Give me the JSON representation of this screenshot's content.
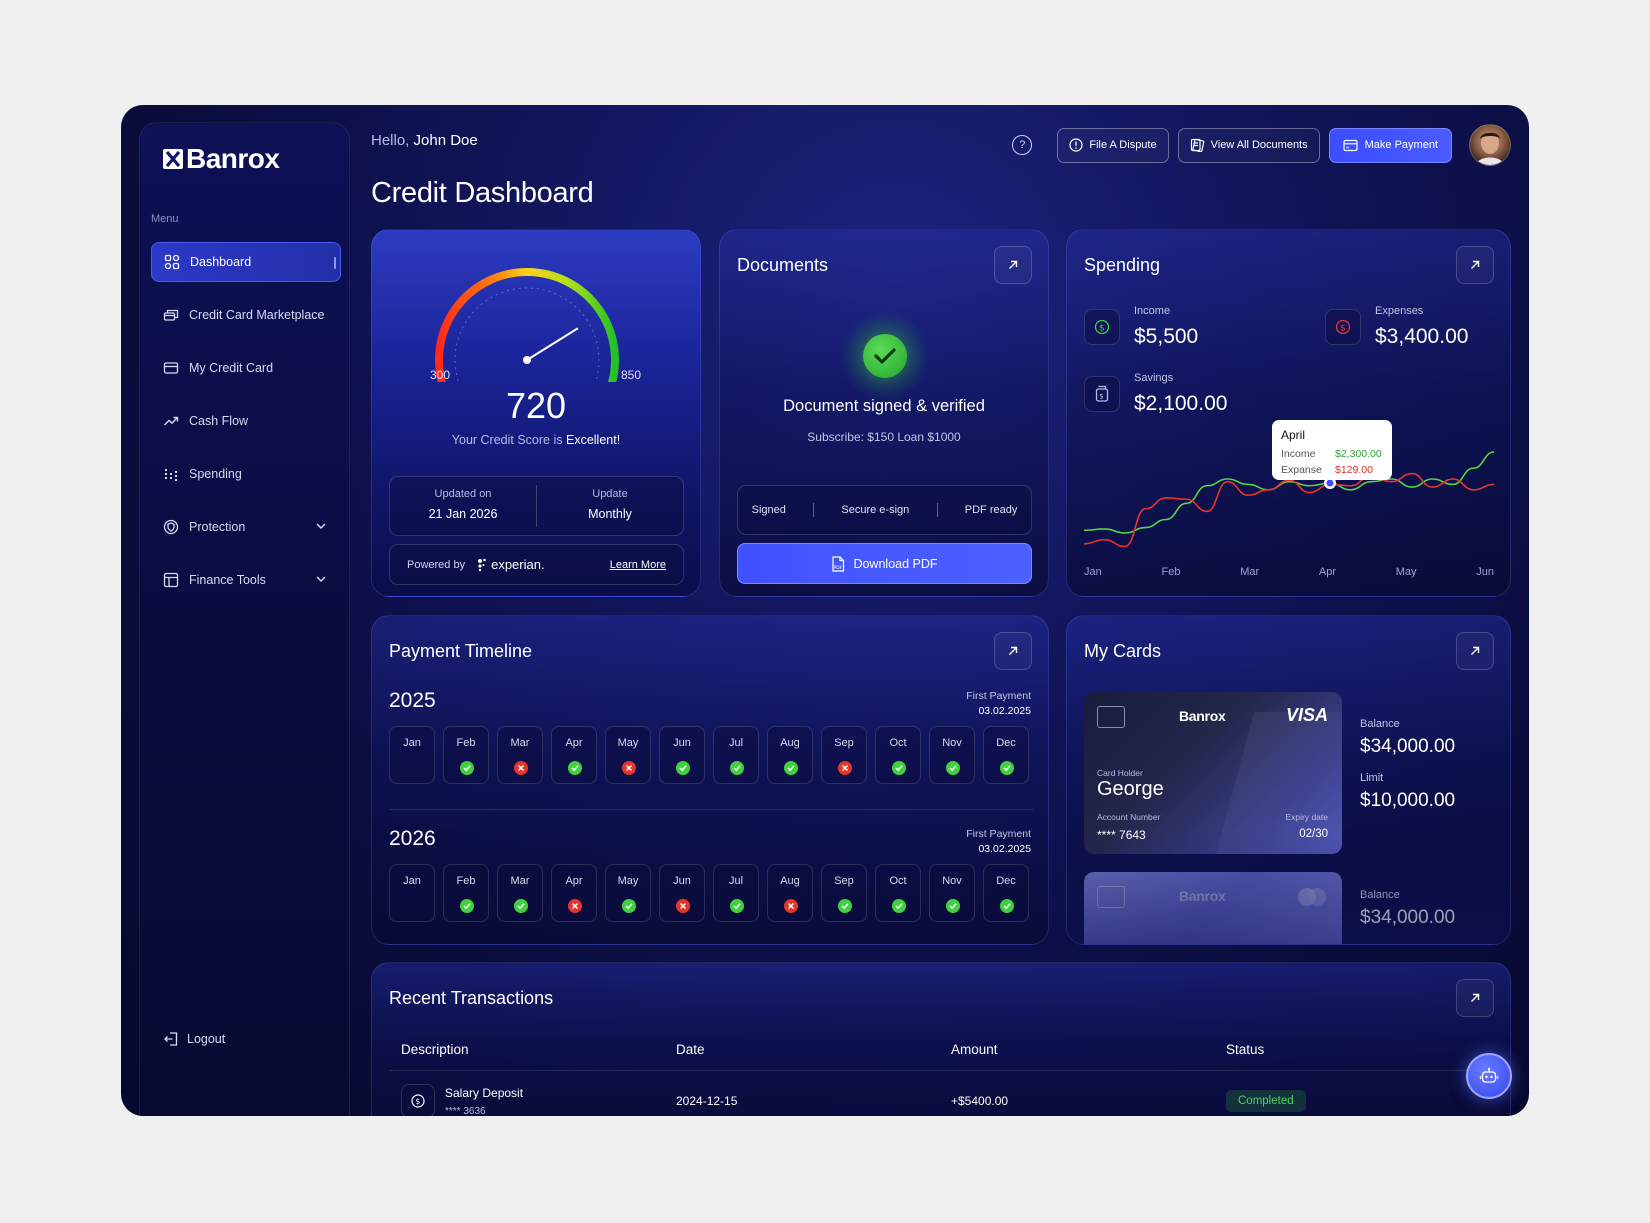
{
  "app": {
    "brand": "Banrox",
    "greeting_prefix": "Hello,",
    "user_name": "John Doe",
    "page_title": "Credit Dashboard"
  },
  "sidebar": {
    "menu_label": "Menu",
    "items": [
      {
        "label": "Dashboard",
        "icon": "grid-icon",
        "active": true
      },
      {
        "label": "Credit Card Marketplace",
        "icon": "cards-stack-icon"
      },
      {
        "label": "My Credit Card",
        "icon": "credit-card-icon"
      },
      {
        "label": "Cash Flow",
        "icon": "trend-up-icon"
      },
      {
        "label": "Spending",
        "icon": "bar-chart-icon"
      },
      {
        "label": "Protection",
        "icon": "shield-icon",
        "expandable": true
      },
      {
        "label": "Finance Tools",
        "icon": "calculator-icon",
        "expandable": true
      }
    ],
    "logout_label": "Logout"
  },
  "header": {
    "file_dispute": "File A Dispute",
    "view_documents": "View All Documents",
    "make_payment": "Make Payment"
  },
  "credit_score": {
    "min": "300",
    "max": "850",
    "score": "720",
    "score_fraction": 0.76,
    "text_prefix": "Your Credit Score is",
    "rating": "Excellent!",
    "updated_label": "Updated on",
    "updated_value": "21 Jan 2026",
    "update_label": "Update",
    "update_value": "Monthly",
    "powered_by": "Powered by",
    "provider": "experian.",
    "learn_more": "Learn More"
  },
  "documents": {
    "title": "Documents",
    "status": "Document signed & verified",
    "subtitle": "Subscribe: $150 Loan $1000",
    "tags": [
      "Signed",
      "Secure e-sign",
      "PDF ready"
    ],
    "download": "Download PDF"
  },
  "spending": {
    "title": "Spending",
    "income_label": "Income",
    "income_value": "$5,500",
    "expenses_label": "Expenses",
    "expenses_value": "$3,400.00",
    "savings_label": "Savings",
    "savings_value": "$2,100.00",
    "tooltip": {
      "month": "April",
      "income_label": "Income",
      "income_value": "$2,300.00",
      "expense_label": "Expanse",
      "expense_value": "$129.00"
    },
    "months": [
      "Jan",
      "Feb",
      "Mar",
      "Apr",
      "May",
      "Jun"
    ],
    "colors": {
      "income": "#56d445",
      "expense": "#e8342e"
    }
  },
  "chart_data": {
    "type": "line",
    "x": [
      0,
      0.25,
      0.5,
      0.75,
      1,
      1.25,
      1.5,
      1.75,
      2,
      2.25,
      2.5,
      2.75,
      3,
      3.25,
      3.5,
      3.75,
      4,
      4.25,
      4.5,
      4.75,
      5
    ],
    "categories": [
      "Jan",
      "Feb",
      "Mar",
      "Apr",
      "May",
      "Jun"
    ],
    "series": [
      {
        "name": "Income",
        "values": [
          22,
          23,
          20,
          24,
          30,
          42,
          55,
          60,
          56,
          52,
          58,
          55,
          57,
          52,
          58,
          60,
          54,
          60,
          56,
          68,
          80
        ]
      },
      {
        "name": "Expense",
        "values": [
          12,
          15,
          10,
          38,
          46,
          45,
          36,
          58,
          48,
          52,
          59,
          50,
          56,
          55,
          62,
          58,
          64,
          54,
          60,
          52,
          56
        ]
      }
    ],
    "ylim": [
      0,
      100
    ],
    "highlight": {
      "x": 3,
      "month": "April"
    }
  },
  "timeline": {
    "title": "Payment Timeline",
    "first_payment_label": "First Payment",
    "years": [
      {
        "year": "2025",
        "first_payment": "03.02.2025",
        "months": [
          {
            "m": "Jan",
            "s": "none"
          },
          {
            "m": "Feb",
            "s": "ok"
          },
          {
            "m": "Mar",
            "s": "bad"
          },
          {
            "m": "Apr",
            "s": "ok"
          },
          {
            "m": "May",
            "s": "bad"
          },
          {
            "m": "Jun",
            "s": "ok"
          },
          {
            "m": "Jul",
            "s": "ok"
          },
          {
            "m": "Aug",
            "s": "ok"
          },
          {
            "m": "Sep",
            "s": "bad"
          },
          {
            "m": "Oct",
            "s": "ok"
          },
          {
            "m": "Nov",
            "s": "ok"
          },
          {
            "m": "Dec",
            "s": "ok"
          }
        ]
      },
      {
        "year": "2026",
        "first_payment": "03.02.2025",
        "months": [
          {
            "m": "Jan",
            "s": "none"
          },
          {
            "m": "Feb",
            "s": "ok"
          },
          {
            "m": "Mar",
            "s": "ok"
          },
          {
            "m": "Apr",
            "s": "bad"
          },
          {
            "m": "May",
            "s": "ok"
          },
          {
            "m": "Jun",
            "s": "bad"
          },
          {
            "m": "Jul",
            "s": "ok"
          },
          {
            "m": "Aug",
            "s": "bad"
          },
          {
            "m": "Sep",
            "s": "ok"
          },
          {
            "m": "Oct",
            "s": "ok"
          },
          {
            "m": "Nov",
            "s": "ok"
          },
          {
            "m": "Dec",
            "s": "ok"
          }
        ]
      }
    ]
  },
  "my_cards": {
    "title": "My Cards",
    "card": {
      "brand": "Banrox",
      "network": "VISA",
      "holder_label": "Card Holder",
      "holder": "George",
      "account_label": "Account Number",
      "account": "**** 7643",
      "expiry_label": "Expiry date",
      "expiry": "02/30"
    },
    "card2_brand": "Banrox",
    "balance_label": "Balance",
    "balance": "$34,000.00",
    "limit_label": "Limit",
    "limit": "$10,000.00",
    "balance2_label": "Balance",
    "balance2": "$34,000.00"
  },
  "transactions": {
    "title": "Recent Transactions",
    "columns": [
      "Description",
      "Date",
      "Amount",
      "Status"
    ],
    "rows": [
      {
        "description": "Salary Deposit",
        "account": "**** 3636",
        "date": "2024-12-15",
        "amount": "+$5400.00",
        "status": "Completed"
      }
    ]
  }
}
